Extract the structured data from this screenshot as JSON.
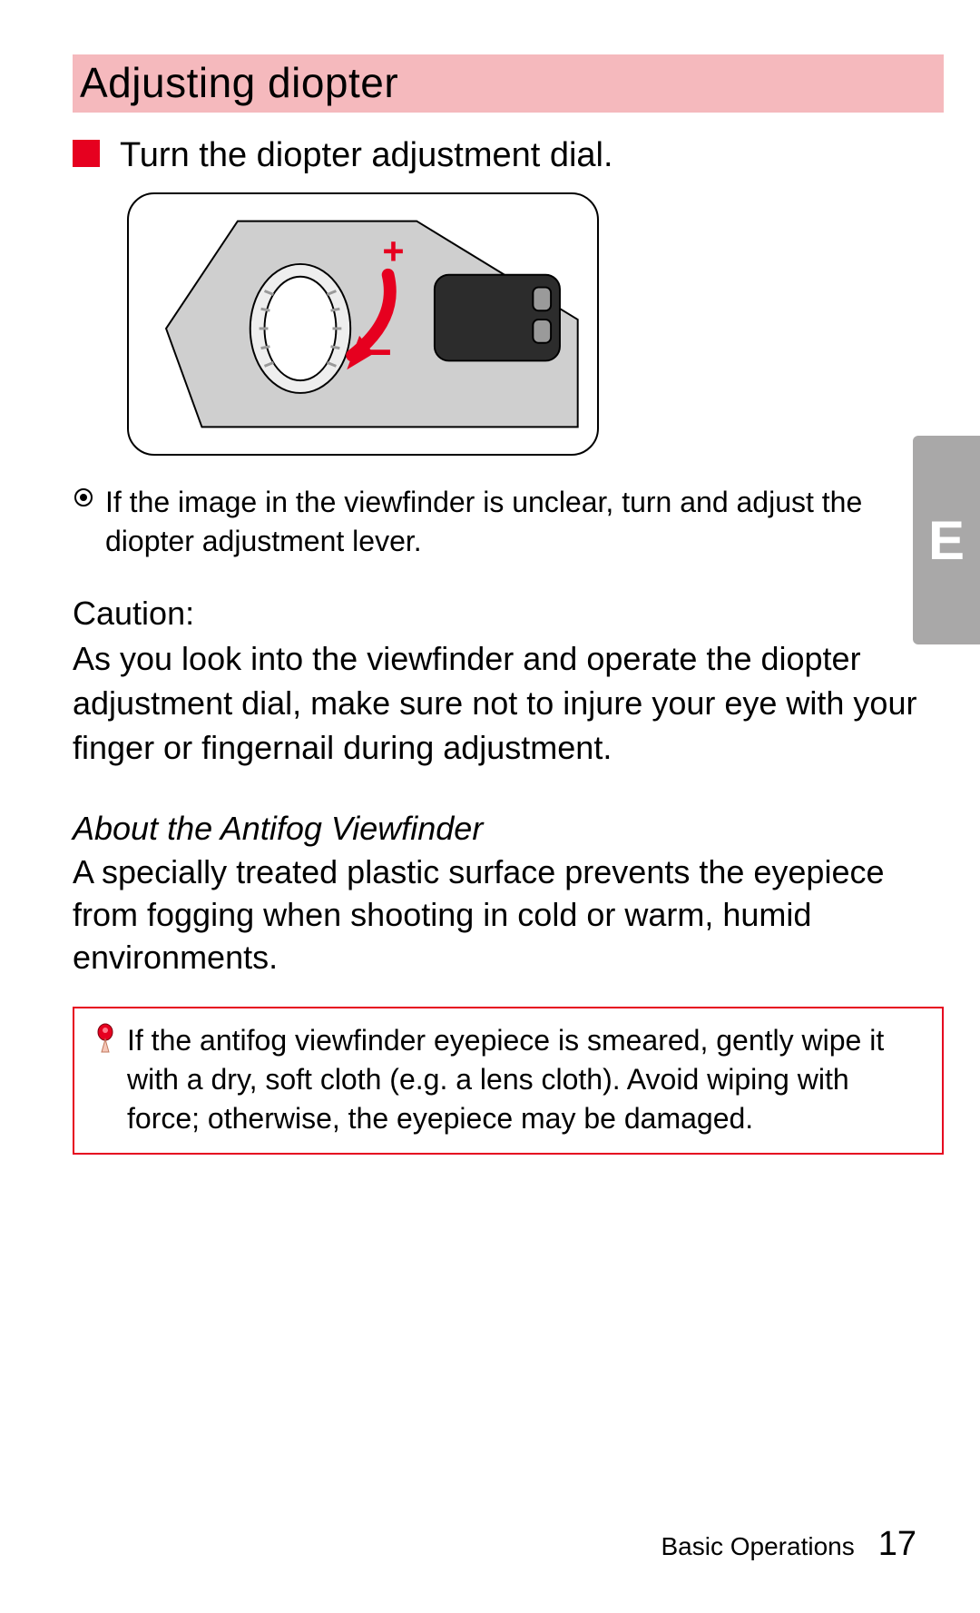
{
  "title": "Adjusting diopter",
  "instruction": "Turn the diopter adjustment dial.",
  "tip": "If the image in the viewfinder is unclear, turn and adjust the diopter adjustment lever.",
  "caution": {
    "label": "Caution:",
    "body": "As you look into the viewfinder and operate the diopter adjustment dial, make sure not to injure your eye with your finger or fingernail during adjustment."
  },
  "edge_tab_letter": "E",
  "antifog": {
    "heading": "About the Antifog Viewfinder",
    "body": "A specially treated plastic surface prevents the eyepiece from fogging when shooting in cold or warm, humid environments."
  },
  "note": "If the antifog viewfinder eyepiece is smeared, gently wipe it with a dry, soft cloth (e.g. a lens cloth).  Avoid wiping with force; otherwise, the eyepiece may be damaged.",
  "footer": {
    "section": "Basic Operations",
    "page": "17"
  },
  "diagram_labels": {
    "plus": "+",
    "minus": "–"
  }
}
